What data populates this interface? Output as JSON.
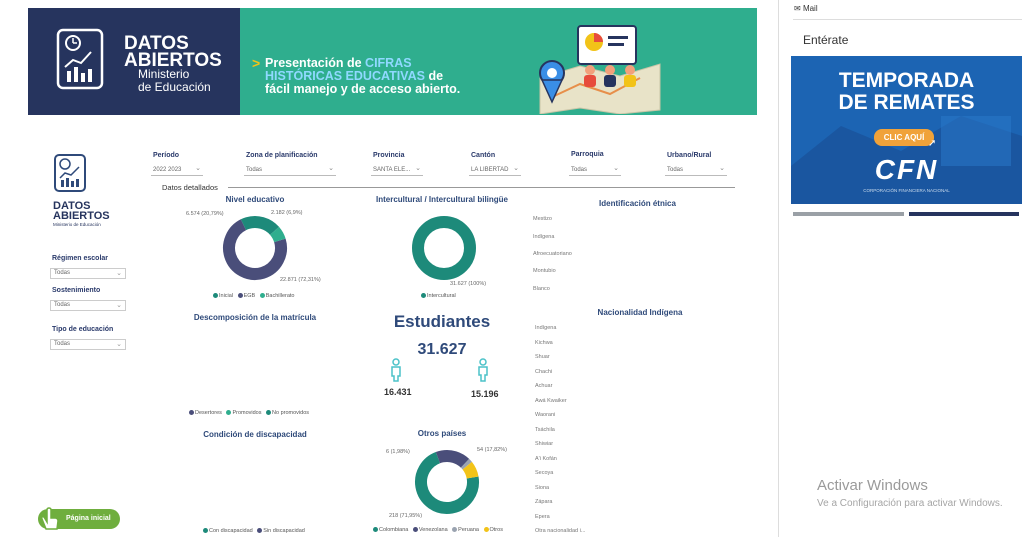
{
  "banner": {
    "title1": "DATOS",
    "title2": "ABIERTOS",
    "subtitle1": "Ministerio",
    "subtitle2": "de Educación",
    "msg_prefix": "Presentación de ",
    "msg_hl1": "CIFRAS",
    "msg_hl2": "HISTÓRICAS EDUCATIVAS",
    "msg_suffix1": " de",
    "msg_line3": "fácil manejo y de acceso abierto."
  },
  "logo": {
    "title1": "DATOS",
    "title2": "ABIERTOS",
    "caption": "Ministerio de Educación"
  },
  "filters": [
    {
      "label": "Período",
      "value": "2022 2023"
    },
    {
      "label": "Zona de planificación",
      "value": "Todas"
    },
    {
      "label": "Provincia",
      "value": "SANTA ELE..."
    },
    {
      "label": "Cantón",
      "value": "LA LIBERTAD"
    },
    {
      "label": "Parroquia",
      "value": "Todas"
    },
    {
      "label": "Urbano/Rural",
      "value": "Todas"
    }
  ],
  "sidebar": {
    "regimen_label": "Régimen escolar",
    "regimen_value": "Todas",
    "sostenimiento_label": "Sostenimiento",
    "sostenimiento_value": "Todas",
    "tipo_label": "Tipo de educación",
    "tipo_value": "Todas",
    "home_button": "Página inicial"
  },
  "detalle_label": "Datos detallados",
  "nivel": {
    "title": "Nivel educativo",
    "label_a": "6.574 (20,79%)",
    "label_b": "2.182 (6,9%)",
    "label_c": "22.871 (72,31%)",
    "legend": [
      "Inicial",
      "EGB",
      "Bachillerato"
    ]
  },
  "intercultural": {
    "title": "Intercultural / Intercultural bilingüe",
    "label": "31.627 (100%)",
    "legend": [
      "Intercultural"
    ]
  },
  "etnica": {
    "title": "Identificación étnica",
    "items": [
      "Mestizo",
      "Indígena",
      "Afroecuatoriano",
      "Montubio",
      "Blanco"
    ]
  },
  "descomposicion": {
    "title": "Descomposición de la matrícula",
    "legend": [
      "Desertores",
      "Promovidos",
      "No promovidos"
    ]
  },
  "estudiantes": {
    "title": "Estudiantes",
    "total": "31.627",
    "female": "16.431",
    "male": "15.196"
  },
  "nacionalidad": {
    "title": "Nacionalidad Indígena",
    "items": [
      "Indígena",
      "Kichwa",
      "Shuar",
      "Chachi",
      "Achuar",
      "Awá Kwaiker",
      "Waorani",
      "Tsáchila",
      "Shiwiar",
      "A'i Kofán",
      "Secoya",
      "Siona",
      "Zápara",
      "Epera",
      "Otra nacionalidad i..."
    ]
  },
  "discapacidad": {
    "title": "Condición de discapacidad",
    "legend": [
      "Con discapacidad",
      "Sin discapacidad"
    ]
  },
  "otros": {
    "title": "Otros países",
    "label_a": "6 (1,98%)",
    "label_b": "54 (17,82%)",
    "label_c": "218 (71,95%)",
    "legend": [
      "Colombiana",
      "Venezolana",
      "Peruana",
      "Otros"
    ]
  },
  "right": {
    "mail": "Mail",
    "enterate": "Entérate",
    "ad_line1": "TEMPORADA",
    "ad_line2": "DE REMATES",
    "ad_button": "CLIC AQUÍ",
    "ad_brand": "CFN",
    "ad_caption": "CORPORACIÓN FINANCIERA NACIONAL"
  },
  "watermark": {
    "line1": "Activar Windows",
    "line2": "Ve a Configuración para activar Windows."
  },
  "colors": {
    "navy": "#4a4e7a",
    "teal": "#1d8a7a",
    "tealLight": "#2fae8e",
    "yellow": "#f2c318",
    "grey": "#9aa3b0"
  }
}
